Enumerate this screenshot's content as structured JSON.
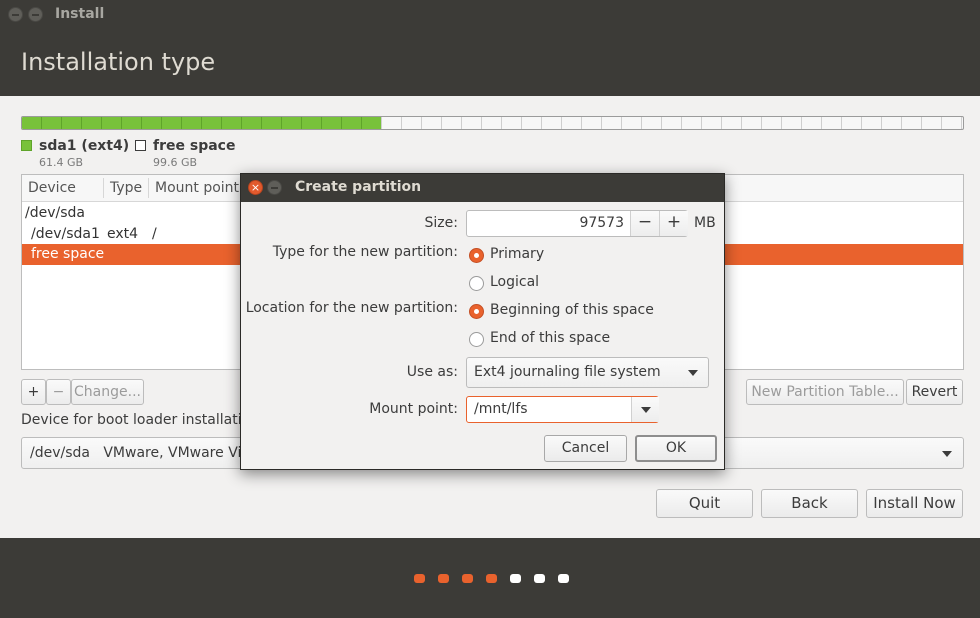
{
  "window": {
    "title": "Install"
  },
  "page": {
    "title": "Installation type"
  },
  "partition_bar": {
    "used_fraction": 0.381,
    "colors": {
      "used": "#78c23a",
      "free": "#f7f7f7"
    }
  },
  "legend": [
    {
      "name": "sda1 (ext4)",
      "size": "61.4 GB",
      "color": "#78c23a"
    },
    {
      "name": "free space",
      "size": "99.6 GB",
      "color": "#ffffff"
    }
  ],
  "table": {
    "columns": [
      "Device",
      "Type",
      "Mount point"
    ],
    "rows": [
      {
        "device": "/dev/sda",
        "type": "",
        "mount": ""
      },
      {
        "device": "/dev/sda1",
        "type": "ext4",
        "mount": "/"
      },
      {
        "device": "free space",
        "type": "",
        "mount": "",
        "selected": true
      }
    ]
  },
  "table_buttons": {
    "add": "+",
    "remove": "−",
    "change": "Change...",
    "new_table": "New Partition Table...",
    "revert": "Revert"
  },
  "bootloader": {
    "label": "Device for boot loader installation:",
    "device": "/dev/sda",
    "description": "VMware, VMware Vi"
  },
  "nav_buttons": {
    "quit": "Quit",
    "back": "Back",
    "install": "Install Now"
  },
  "progress_dots": {
    "total": 7,
    "completed": 4,
    "color_done": "#e9622d",
    "color_todo": "#ffffff"
  },
  "dialog": {
    "title": "Create partition",
    "size_label": "Size:",
    "size_value": "97573",
    "size_unit": "MB",
    "minus": "−",
    "plus": "+",
    "type_label": "Type for the new partition:",
    "type_options": [
      "Primary",
      "Logical"
    ],
    "type_selected": "Primary",
    "location_label": "Location for the new partition:",
    "location_options": [
      "Beginning of this space",
      "End of this space"
    ],
    "location_selected": "Beginning of this space",
    "use_as_label": "Use as:",
    "use_as_value": "Ext4 journaling file system",
    "mount_label": "Mount point:",
    "mount_value": "/mnt/lfs",
    "cancel": "Cancel",
    "ok": "OK"
  },
  "accent": "#e9622d"
}
